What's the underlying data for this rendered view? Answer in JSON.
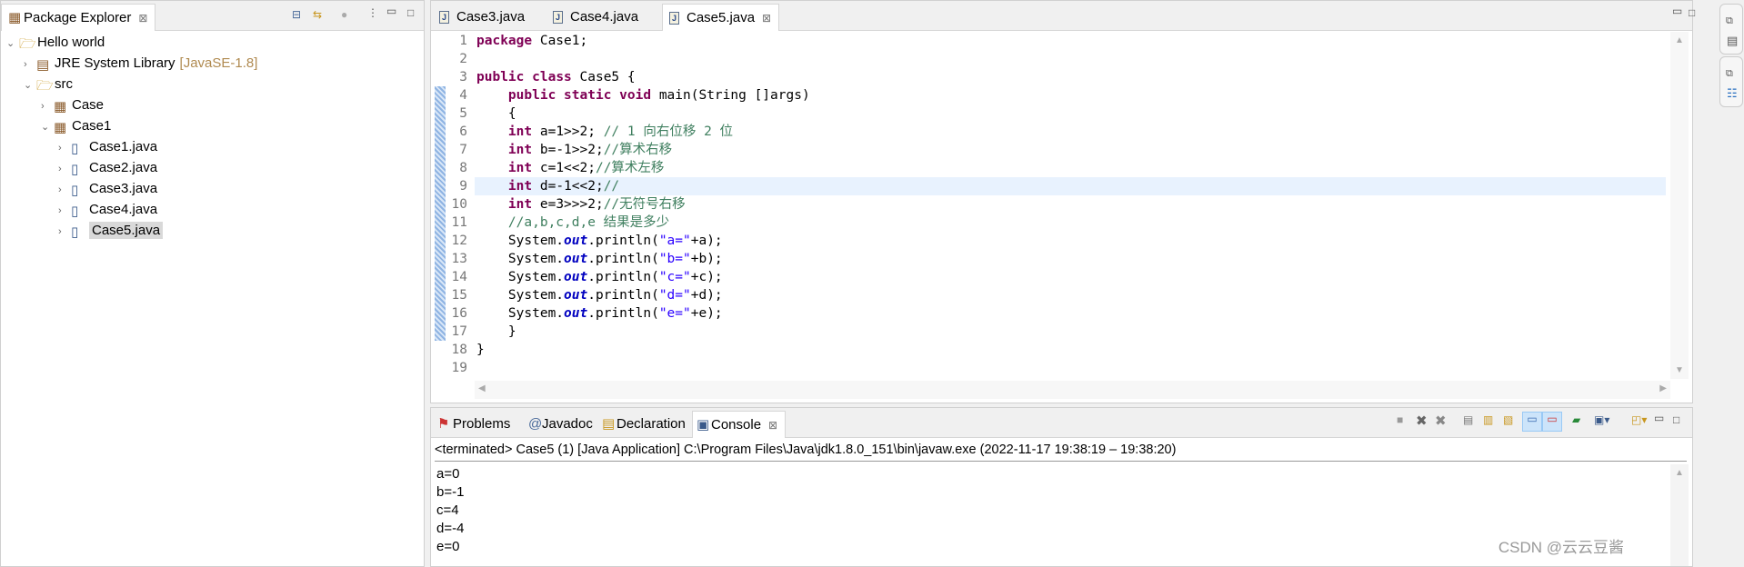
{
  "package_explorer": {
    "title": "Package Explorer",
    "tree": [
      {
        "label": "Hello world",
        "depth": 0,
        "expanded": true,
        "icon": "project-icon"
      },
      {
        "label": "JRE System Library",
        "suffix": "[JavaSE-1.8]",
        "depth": 1,
        "expanded": false,
        "icon": "library-icon"
      },
      {
        "label": "src",
        "depth": 1,
        "expanded": true,
        "icon": "source-folder-icon"
      },
      {
        "label": "Case",
        "depth": 2,
        "expanded": false,
        "icon": "package-icon"
      },
      {
        "label": "Case1",
        "depth": 2,
        "expanded": true,
        "icon": "package-icon"
      },
      {
        "label": "Case1.java",
        "depth": 3,
        "expanded": false,
        "icon": "java-file-warning-icon"
      },
      {
        "label": "Case2.java",
        "depth": 3,
        "expanded": false,
        "icon": "java-file-icon"
      },
      {
        "label": "Case3.java",
        "depth": 3,
        "expanded": false,
        "icon": "java-file-warning-icon"
      },
      {
        "label": "Case4.java",
        "depth": 3,
        "expanded": false,
        "icon": "java-file-icon"
      },
      {
        "label": "Case5.java",
        "depth": 3,
        "expanded": false,
        "icon": "java-file-icon",
        "selected": true
      }
    ]
  },
  "editor": {
    "tabs": [
      {
        "label": "Case3.java",
        "active": false
      },
      {
        "label": "Case4.java",
        "active": false
      },
      {
        "label": "Case5.java",
        "active": true
      }
    ],
    "highlighted_line": 9,
    "lines": [
      "package Case1;",
      "",
      "public class Case5 {",
      "    public static void main(String []args)",
      "    {",
      "    int a=1>>2; // 1 向右位移 2 位",
      "    int b=-1>>2;//算术右移",
      "    int c=1<<2;//算术左移",
      "    int d=-1<<2;//",
      "    int e=3>>>2;//无符号右移",
      "    //a,b,c,d,e 结果是多少",
      "    System.out.println(\"a=\"+a);",
      "    System.out.println(\"b=\"+b);",
      "    System.out.println(\"c=\"+c);",
      "    System.out.println(\"d=\"+d);",
      "    System.out.println(\"e=\"+e);",
      "    }",
      "}",
      ""
    ]
  },
  "bottom": {
    "tabs": [
      {
        "label": "Problems",
        "active": false
      },
      {
        "label": "Javadoc",
        "active": false
      },
      {
        "label": "Declaration",
        "active": false
      },
      {
        "label": "Console",
        "active": true
      }
    ],
    "console_header": "<terminated> Case5 (1) [Java Application] C:\\Program Files\\Java\\jdk1.8.0_151\\bin\\javaw.exe  (2022-11-17 19:38:19 – 19:38:20)",
    "output": [
      "a=0",
      "b=-1",
      "c=4",
      "d=-4",
      "e=0"
    ]
  },
  "watermark": "CSDN @云云豆酱",
  "colors": {
    "keyword": "#7f0055",
    "comment": "#3f7f5f",
    "string": "#2a00ff",
    "field": "#0000c0",
    "current_line": "#e8f2fe",
    "selection": "#d9d9d9"
  }
}
